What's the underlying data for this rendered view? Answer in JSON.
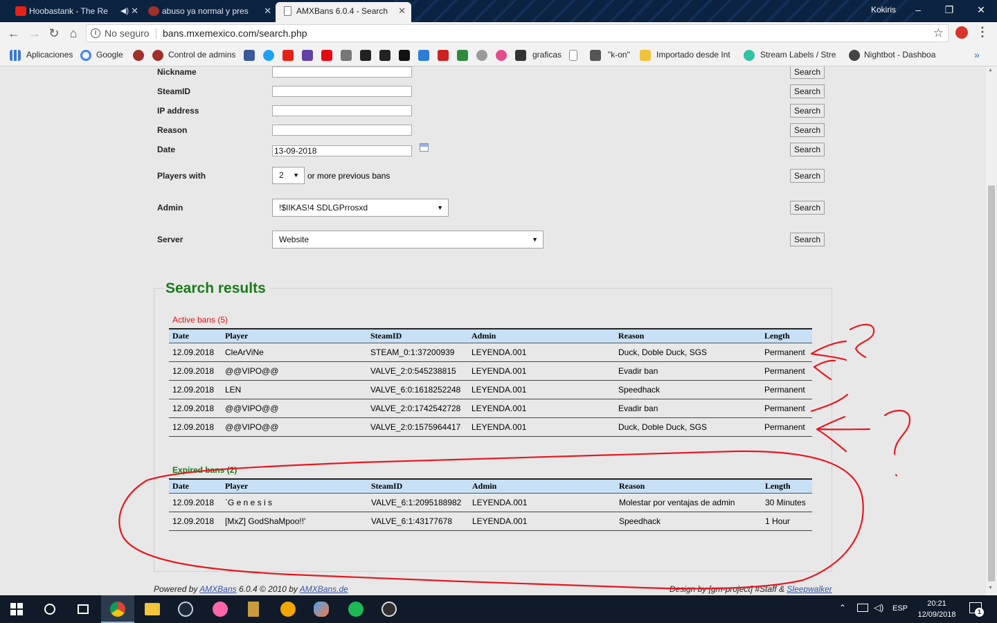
{
  "browser": {
    "tabs": [
      {
        "title": "Hoobastank - The Re",
        "active": false,
        "audio": true
      },
      {
        "title": "abuso ya normal y pres",
        "active": false,
        "audio": false
      },
      {
        "title": "AMXBans 6.0.4 - Search",
        "active": true,
        "audio": false
      }
    ],
    "profile_name": "Kokiris",
    "security_label": "No seguro",
    "url": "bans.mxemexico.com/search.php",
    "bookmarks": [
      "Aplicaciones",
      "Google",
      "Control de admins",
      "graficas",
      "\"k-on\"",
      "Importado desde Int",
      "Stream Labels / Stre",
      "Nightbot - Dashboa"
    ],
    "overflow": "»"
  },
  "form": {
    "fields": [
      {
        "label": "Nickname",
        "value": ""
      },
      {
        "label": "SteamID",
        "value": ""
      },
      {
        "label": "IP address",
        "value": ""
      },
      {
        "label": "Reason",
        "value": ""
      },
      {
        "label": "Date",
        "value": "13-09-2018"
      }
    ],
    "players_with": {
      "label": "Players with",
      "value": "2",
      "suffix": "or more previous bans"
    },
    "admin": {
      "label": "Admin",
      "value": "!$IIKAS!4 SDLGPrrosxd"
    },
    "server": {
      "label": "Server",
      "value": "Website"
    },
    "search_label": "Search"
  },
  "results": {
    "title": "Search results",
    "active_title": "Active bans (5)",
    "expired_title": "Expired bans (2)",
    "columns": [
      "Date",
      "Player",
      "SteamID",
      "Admin",
      "Reason",
      "Length"
    ],
    "active": [
      [
        "12.09.2018",
        "CleArViNe",
        "STEAM_0:1:37200939",
        "LEYENDA.001",
        "Duck, Doble Duck, SGS",
        "Permanent"
      ],
      [
        "12.09.2018",
        "@@VIPO@@",
        "VALVE_2:0:545238815",
        "LEYENDA.001",
        "Evadir ban",
        "Permanent"
      ],
      [
        "12.09.2018",
        "LEN",
        "VALVE_6:0:1618252248",
        "LEYENDA.001",
        "Speedhack",
        "Permanent"
      ],
      [
        "12.09.2018",
        "@@VIPO@@",
        "VALVE_2:0:1742542728",
        "LEYENDA.001",
        "Evadir ban",
        "Permanent"
      ],
      [
        "12.09.2018",
        "@@VIPO@@",
        "VALVE_2:0:1575964417",
        "LEYENDA.001",
        "Duck, Doble Duck, SGS",
        "Permanent"
      ]
    ],
    "expired": [
      [
        "12.09.2018",
        "`G e n e s i s",
        "VALVE_6:1:2095188982",
        "LEYENDA.001",
        "Molestar por ventajas de admin",
        "30 Minutes"
      ],
      [
        "12.09.2018",
        "[MxZ] GodShaMpoo!!'",
        "VALVE_6:1:43177678",
        "LEYENDA.001",
        "Speedhack",
        "1 Hour"
      ]
    ]
  },
  "footer": {
    "powered_prefix": "Powered by ",
    "powered_link": "AMXBans",
    "powered_mid": " 6.0.4 © 2010 by ",
    "powered_site": "AMXBans.de",
    "design_prefix": "Design by [gm-project] #Staff & ",
    "design_link": "Sleepwalker"
  },
  "taskbar": {
    "language": "ESP",
    "time": "20:21",
    "date": "12/09/2018",
    "notifications": "1"
  },
  "colors": {
    "header_row": "#c8e0f5",
    "active_title": "#dd1111",
    "results_title": "#1a7a1a",
    "annotation": "#e8171f"
  }
}
